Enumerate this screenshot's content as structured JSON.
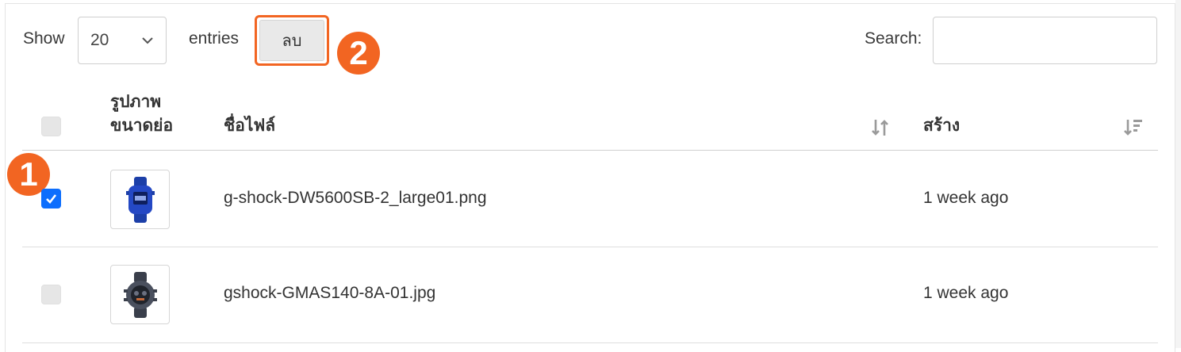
{
  "length_menu": {
    "show_label": "Show",
    "value": "20",
    "entries_label": "entries"
  },
  "delete_button": {
    "label": "ลบ"
  },
  "annotations": {
    "step1": "1",
    "step2": "2"
  },
  "search": {
    "label": "Search:",
    "value": ""
  },
  "table": {
    "headers": {
      "thumbnail_line1": "รูปภาพ",
      "thumbnail_line2": "ขนาดย่อ",
      "filename": "ชื่อไฟล์",
      "created": "สร้าง"
    },
    "rows": [
      {
        "checked": true,
        "thumbnail_icon": "blue-gshock-watch",
        "filename": "g-shock-DW5600SB-2_large01.png",
        "created": "1 week ago"
      },
      {
        "checked": false,
        "thumbnail_icon": "grey-gshock-watch",
        "filename": "gshock-GMAS140-8A-01.jpg",
        "created": "1 week ago"
      }
    ]
  },
  "colors": {
    "accent": "#f26522",
    "checkbox_checked": "#0d6efd"
  }
}
